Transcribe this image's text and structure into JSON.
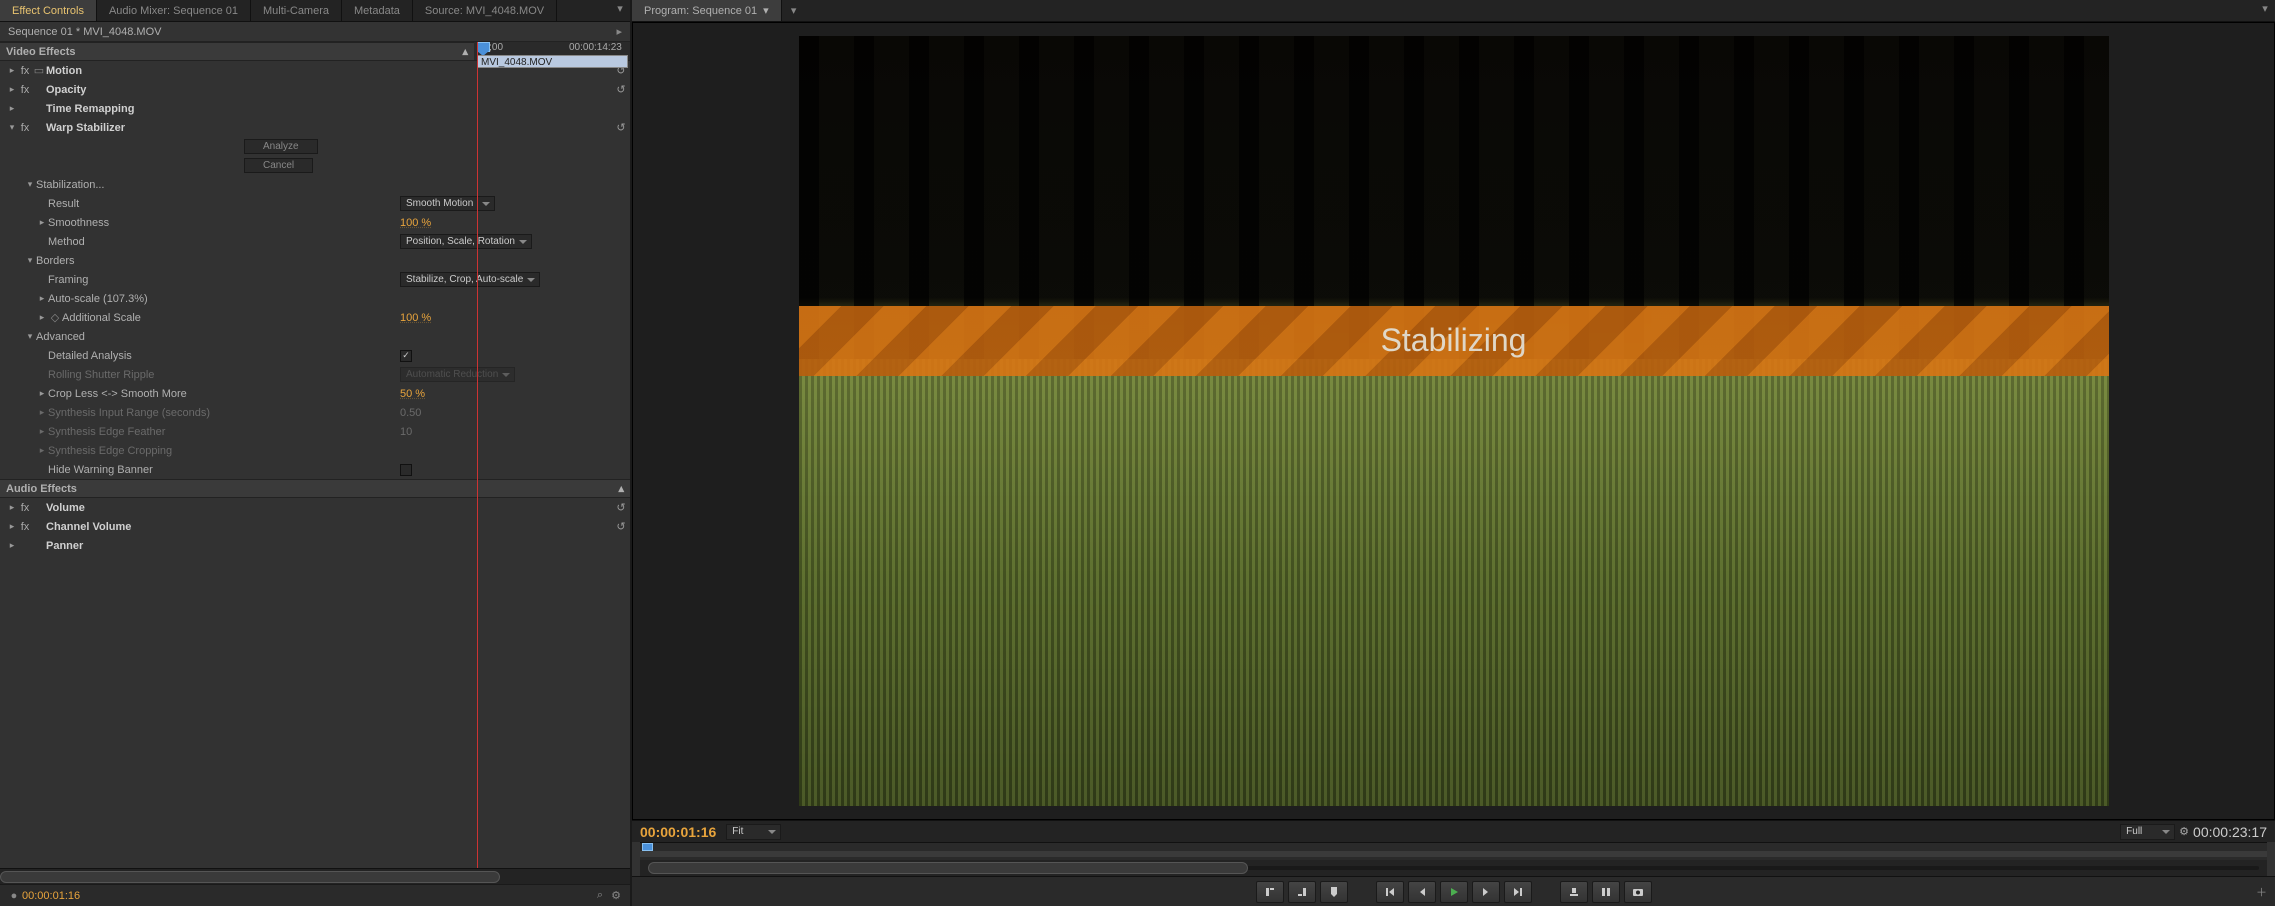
{
  "leftPanel": {
    "tabs": [
      "Effect Controls",
      "Audio Mixer: Sequence 01",
      "Multi-Camera",
      "Metadata",
      "Source: MVI_4048.MOV"
    ],
    "activeTab": 0,
    "seqHeader": "Sequence 01 * MVI_4048.MOV",
    "timeline": {
      "t0": "00;00",
      "t1": "00:00:14:23",
      "clipName": "MVI_4048.MOV"
    },
    "videoEffectsTitle": "Video Effects",
    "effects": {
      "motion": "Motion",
      "opacity": "Opacity",
      "timeRemap": "Time Remapping",
      "warp": {
        "name": "Warp Stabilizer",
        "analyze": "Analyze",
        "cancel": "Cancel",
        "stabilization": "Stabilization...",
        "result_lbl": "Result",
        "result_val": "Smooth Motion",
        "smoothness_lbl": "Smoothness",
        "smoothness_val": "100 %",
        "method_lbl": "Method",
        "method_val": "Position, Scale, Rotation",
        "borders": "Borders",
        "framing_lbl": "Framing",
        "framing_val": "Stabilize, Crop, Auto-scale",
        "autoscale_lbl": "Auto-scale (107.3%)",
        "addscale_lbl": "Additional Scale",
        "addscale_val": "100 %",
        "advanced": "Advanced",
        "detailed_lbl": "Detailed Analysis",
        "detailed_chk": true,
        "rolling_lbl": "Rolling Shutter Ripple",
        "rolling_val": "Automatic Reduction",
        "cropless_lbl": "Crop Less <-> Smooth More",
        "cropless_val": "50 %",
        "synthinput_lbl": "Synthesis Input Range (seconds)",
        "synthinput_val": "0.50",
        "synthedge_lbl": "Synthesis Edge Feather",
        "synthedge_val": "10",
        "synthcrop_lbl": "Synthesis Edge Cropping",
        "hidewarn_lbl": "Hide Warning Banner",
        "hidewarn_chk": false
      }
    },
    "audioEffectsTitle": "Audio Effects",
    "audio": {
      "volume": "Volume",
      "channelVolume": "Channel Volume",
      "panner": "Panner"
    },
    "statusTC": "00:00:01:16"
  },
  "rightPanel": {
    "tabTitle": "Program: Sequence 01",
    "bannerText": "Stabilizing",
    "tcIn": "00:00:01:16",
    "fit": "Fit",
    "full": "Full",
    "tcOut": "00:00:23:17"
  }
}
